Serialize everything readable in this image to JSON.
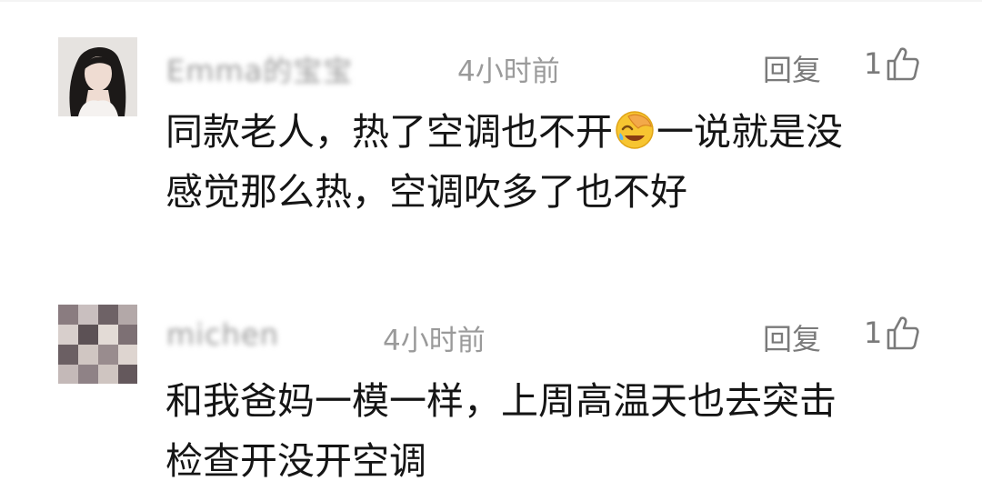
{
  "comments": [
    {
      "username": "Emma的宝宝",
      "time": "4小时前",
      "reply_label": "回复",
      "like_count": "1",
      "line1_before": "同款老人，热了空调也不开",
      "emoji": "facepalm-laugh-emoji",
      "line1_after": "一说就是没",
      "line2": "感觉那么热，空调吹多了也不好"
    },
    {
      "username": "michen",
      "time": "4小时前",
      "reply_label": "回复",
      "like_count": "1",
      "line1": "和我爸妈一模一样，上周高温天也去突击",
      "line2": "检查开没开空调"
    }
  ]
}
